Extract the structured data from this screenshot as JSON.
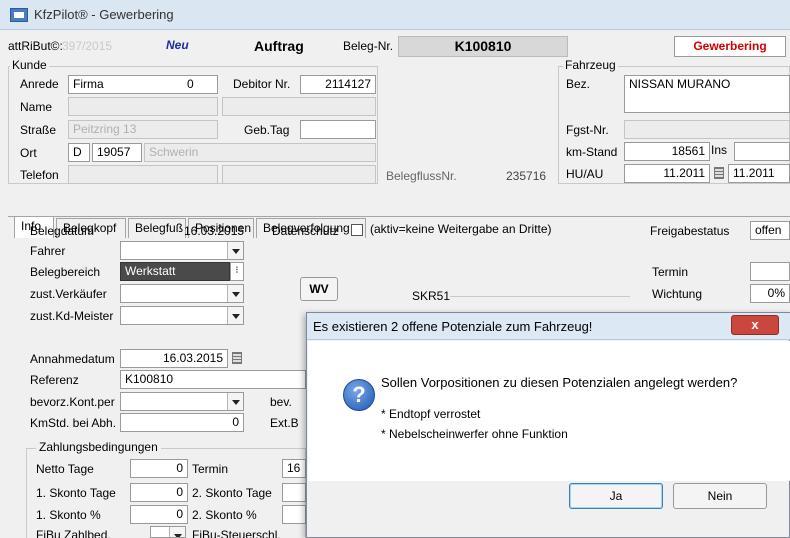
{
  "window": {
    "title": "KfzPilot® - Gewerbering"
  },
  "header": {
    "att_label": "attRiBut©:",
    "att_value": "397/2015",
    "neu": "Neu",
    "auftrag": "Auftrag",
    "belegnr_label": "Beleg-Nr.",
    "belegnr_value": "K100810",
    "firm": "Gewerbering"
  },
  "kunde": {
    "group": "Kunde",
    "anrede_label": "Anrede",
    "anrede_value": "Firma",
    "anrede_num": "0",
    "debitor_label": "Debitor Nr.",
    "debitor_value": "2114127",
    "name_label": "Name",
    "strasse_label": "Straße",
    "strasse_value": "Peitzring 13",
    "gebtag_label": "Geb.Tag",
    "ort_label": "Ort",
    "ort_land": "D",
    "ort_plz": "19057",
    "ort_city": "Schwerin",
    "telefon_label": "Telefon",
    "belegfluss_label": "BelegflussNr.",
    "belegfluss_value": "235716"
  },
  "fahrzeug": {
    "group": "Fahrzeug",
    "bez_label": "Bez.",
    "bez_value": "NISSAN MURANO",
    "fgst_label": "Fgst-Nr.",
    "km_label": "km-Stand",
    "km_value": "18561",
    "ins_label": "Ins",
    "hu_label": "HU/AU",
    "hu_value": "11.2011",
    "au_value": "11.2011"
  },
  "tabs": [
    "Info",
    "Belegkopf",
    "Belegfuß",
    "Positionen",
    "Belegverfolgung"
  ],
  "info": {
    "belegdatum_label": "Belegdatum",
    "belegdatum_value": "16.03.2015",
    "datenschutz_label": "Datenschutz",
    "datenschutz_note": "(aktiv=keine Weitergabe an Dritte)",
    "freigabe_label": "Freigabestatus",
    "freigabe_value": "offen",
    "fahrer_label": "Fahrer",
    "belegbereich_label": "Belegbereich",
    "belegbereich_value": "Werkstatt",
    "termin_label": "Termin",
    "verkaeufer_label": "zust.Verkäufer",
    "wv_label": "WV",
    "skr_label": "SKR51",
    "wichtung_label": "Wichtung",
    "wichtung_value": "0%",
    "kdmeister_label": "zust.Kd-Meister",
    "annahme_label": "Annahmedatum",
    "annahme_value": "16.03.2015",
    "referenz_label": "Referenz",
    "referenz_value": "K100810",
    "bevorz_label": "bevorz.Kont.per",
    "bev_label": "bev.",
    "kmstd_label": "KmStd. bei Abh.",
    "kmstd_value": "0",
    "ext_label": "Ext.B"
  },
  "zahlung": {
    "group": "Zahlungsbedingungen",
    "netto_label": "Netto Tage",
    "netto_value": "0",
    "termin_label": "Termin",
    "termin_value": "16",
    "skonto1_tage_label": "1. Skonto Tage",
    "skonto1_tage_value": "0",
    "skonto2_tage_label": "2. Skonto Tage",
    "skonto1_pct_label": "1. Skonto %",
    "skonto1_pct_value": "0",
    "skonto2_pct_label": "2. Skonto %",
    "fibu_label": "FiBu Zahlbed.",
    "fibu_steuer_label": "FiBu-Steuerschl."
  },
  "dialog": {
    "title": "Es existieren 2 offene Potenziale zum Fahrzeug!",
    "close": "x",
    "question": "Sollen Vorpositionen zu diesen Potenzialen angelegt werden?",
    "items": [
      "* Endtopf  verrostet",
      "* Nebelscheinwerfer  ohne Funktion"
    ],
    "yes": "Ja",
    "no": "Nein"
  },
  "colors": {
    "firm_red": "#d40000",
    "neu_blue": "#1a2ea0",
    "dialog_close": "#c9473e"
  }
}
